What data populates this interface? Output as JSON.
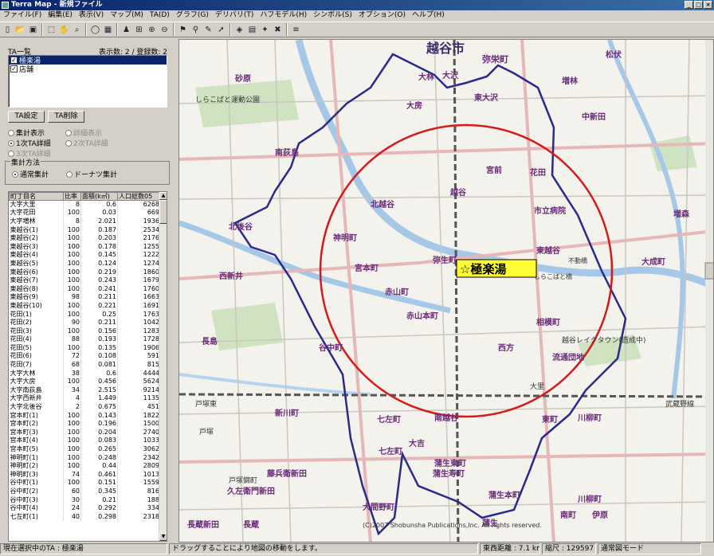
{
  "window": {
    "title": "Terra Map - 新規ファイル"
  },
  "menu": [
    "ファイル(F)",
    "編集(E)",
    "表示(V)",
    "マップ(M)",
    "TA(D)",
    "グラフ(G)",
    "デリバリ(T)",
    "ハフモデル(H)",
    "シンボル(S)",
    "オプション(O)",
    "ヘルプ(H)"
  ],
  "toolbar_icons": [
    "new-file-icon",
    "open-icon",
    "save-icon",
    "sep",
    "select-icon",
    "pan-icon",
    "zoom-icon",
    "sep",
    "circle-icon",
    "grid-icon",
    "sep",
    "people-icon",
    "ruler-icon",
    "zoom-in-icon",
    "zoom-out-icon",
    "sep",
    "flag-icon",
    "pin-icon",
    "pen-icon",
    "arrow-icon",
    "sep",
    "layer-icon",
    "table-icon",
    "symbol-icon",
    "chart-icon",
    "sep",
    "list-icon"
  ],
  "left_panel": {
    "ta_list_label": "TA一覧",
    "count_label": "表示数: 2 / 登録数: 2",
    "ta_items": [
      {
        "label": "極楽湯",
        "selected": true
      },
      {
        "label": "店舗",
        "selected": false
      }
    ],
    "btn_ta_settings": "TA設定",
    "btn_ta_delete": "TA削除",
    "radio_summary": "集計表示",
    "radio_detail": "詳細表示",
    "radio_1st": "1次TA詳細",
    "radio_2nd": "2次TA詳細",
    "radio_3rd": "3次TA詳細",
    "method_label": "集計方法",
    "method_normal": "通常集計",
    "method_donut": "ドーナツ集計",
    "table_headers": [
      "町丁目名",
      "比率",
      "面積(k㎡)",
      "人口総数05"
    ],
    "rows": [
      [
        "大字大里",
        "8",
        "0.6",
        "6268"
      ],
      [
        "大字花田",
        "100",
        "0.03",
        "669"
      ],
      [
        "大字増林",
        "8",
        "2.021",
        "1936"
      ],
      [
        "東越谷(1)",
        "100",
        "0.187",
        "2534"
      ],
      [
        "東越谷(2)",
        "100",
        "0.203",
        "2176"
      ],
      [
        "東越谷(3)",
        "100",
        "0.178",
        "1255"
      ],
      [
        "東越谷(4)",
        "100",
        "0.145",
        "1222"
      ],
      [
        "東越谷(5)",
        "100",
        "0.124",
        "1274"
      ],
      [
        "東越谷(6)",
        "100",
        "0.219",
        "1860"
      ],
      [
        "東越谷(7)",
        "100",
        "0.243",
        "1679"
      ],
      [
        "東越谷(8)",
        "100",
        "0.241",
        "1760"
      ],
      [
        "東越谷(9)",
        "98",
        "0.211",
        "1663"
      ],
      [
        "東越谷(10)",
        "100",
        "0.221",
        "1691"
      ],
      [
        "花田(1)",
        "100",
        "0.25",
        "1763"
      ],
      [
        "花田(2)",
        "90",
        "0.211",
        "1042"
      ],
      [
        "花田(3)",
        "100",
        "0.156",
        "1283"
      ],
      [
        "花田(4)",
        "88",
        "0.193",
        "1728"
      ],
      [
        "花田(5)",
        "100",
        "0.135",
        "1906"
      ],
      [
        "花田(6)",
        "72",
        "0.108",
        "591"
      ],
      [
        "花田(7)",
        "68",
        "0.081",
        "815"
      ],
      [
        "大字大林",
        "38",
        "0.6",
        "4444"
      ],
      [
        "大字大房",
        "100",
        "0.456",
        "5624"
      ],
      [
        "大字南荻島",
        "34",
        "2.515",
        "9214"
      ],
      [
        "大字西新井",
        "4",
        "1.449",
        "1135"
      ],
      [
        "大字北後谷",
        "2",
        "0.675",
        "451"
      ],
      [
        "宮本町(1)",
        "100",
        "0.143",
        "1822"
      ],
      [
        "宮本町(2)",
        "100",
        "0.196",
        "1500"
      ],
      [
        "宮本町(3)",
        "100",
        "0.204",
        "2740"
      ],
      [
        "宮本町(4)",
        "100",
        "0.083",
        "1033"
      ],
      [
        "宮本町(5)",
        "100",
        "0.265",
        "3062"
      ],
      [
        "神明町(1)",
        "100",
        "0.248",
        "2342"
      ],
      [
        "神明町(2)",
        "100",
        "0.44",
        "2809"
      ],
      [
        "神明町(3)",
        "74",
        "0.461",
        "1013"
      ],
      [
        "谷中町(1)",
        "100",
        "0.151",
        "1559"
      ],
      [
        "谷中町(2)",
        "60",
        "0.345",
        "816"
      ],
      [
        "谷中町(3)",
        "30",
        "0.21",
        "188"
      ],
      [
        "谷中町(4)",
        "24",
        "0.292",
        "334"
      ],
      [
        "七左町(1)",
        "40",
        "0.298",
        "2318"
      ]
    ]
  },
  "map": {
    "center_label": "☆極楽湯",
    "copyright": "(C)2007 Shobunsha Publications,Inc. All rights reserved.",
    "labels": [
      "越谷市",
      "弥栄町",
      "大林",
      "大沢",
      "東大沢",
      "増林",
      "松伏",
      "砂原",
      "大房",
      "中新田",
      "南荻島",
      "宮前",
      "花田",
      "北越谷",
      "越谷",
      "北後谷",
      "神明町",
      "市立病院",
      "宮本町",
      "東越谷",
      "増森",
      "大成町",
      "西新井",
      "赤山町",
      "弥生町",
      "赤山本町",
      "相模町",
      "長島",
      "谷中町",
      "西方",
      "流通団地",
      "大吉",
      "戸塚東",
      "新川町",
      "七左町",
      "川柳町",
      "東町",
      "南越谷",
      "大里",
      "戸塚",
      "川柳町",
      "南町",
      "伊原",
      "七左町",
      "藤兵衛新田",
      "久左衛門新田",
      "戸塚錦町",
      "長蔵新田",
      "長蔵",
      "蒲生",
      "蒲生東町",
      "蒲生本町",
      "蒲生寿町",
      "大間野町",
      "武蔵野線",
      "越谷レイクタウン(造成中)",
      "しらこばと運動公園",
      "不動橋",
      "しらこばと橋"
    ]
  },
  "status": {
    "current_ta": "現在選択中のTA : 極楽湯",
    "hint": "ドラッグすることにより地図の移動をします。",
    "distance": "東西距離 : 7.1 km",
    "scale": "縮尺 : 129597",
    "mode": "通常図モード"
  }
}
